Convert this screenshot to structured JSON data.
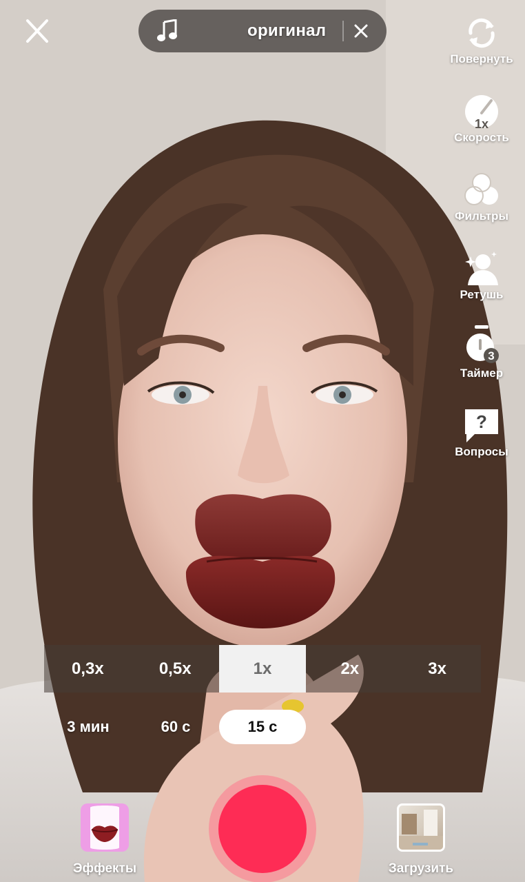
{
  "top": {
    "sound_title": "оригинал"
  },
  "side_tools": [
    {
      "label": "Повернуть"
    },
    {
      "label": "Скорость",
      "badge": "1x"
    },
    {
      "label": "Фильтры"
    },
    {
      "label": "Ретушь"
    },
    {
      "label": "Таймер",
      "badge": "3"
    },
    {
      "label": "Вопросы",
      "badge": "?"
    }
  ],
  "speed_options": [
    "0,3x",
    "0,5x",
    "1x",
    "2x",
    "3x"
  ],
  "speed_selected": "1x",
  "duration_options": [
    "3 мин",
    "60 с",
    "15 с"
  ],
  "duration_selected": "15 с",
  "bottom": {
    "effects_label": "Эффекты",
    "upload_label": "Загрузить"
  },
  "colors": {
    "record": "#fe2c55",
    "effects_thumb": "#ee9ee6"
  }
}
